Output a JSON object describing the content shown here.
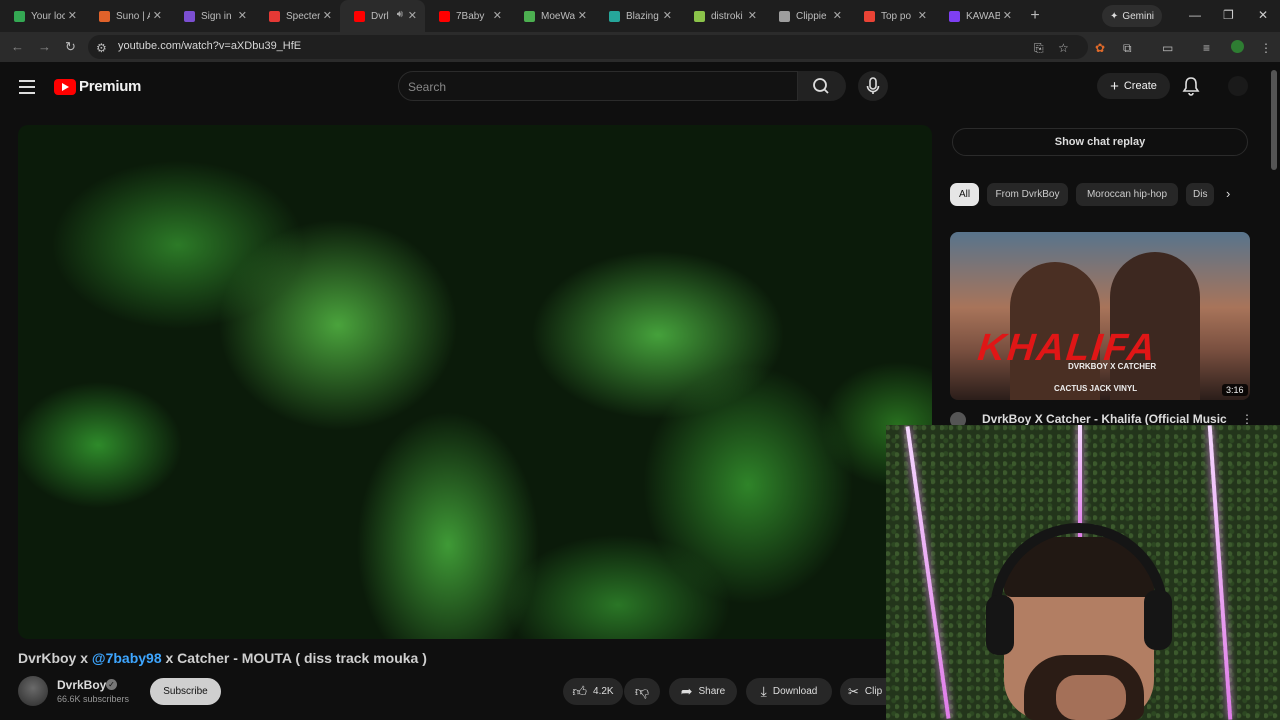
{
  "browser": {
    "tabs": [
      {
        "label": "Your loc",
        "color": "#34a853"
      },
      {
        "label": "Suno | A",
        "color": "#e0622a"
      },
      {
        "label": "Sign in",
        "color": "#7b4fd1"
      },
      {
        "label": "Specterr",
        "color": "#e53935"
      },
      {
        "label": "Dvrl",
        "color": "#ff0000"
      },
      {
        "label": "7Baby",
        "color": "#ff0000"
      },
      {
        "label": "MoeWa",
        "color": "#4caf50"
      },
      {
        "label": "Blazing",
        "color": "#26a69a"
      },
      {
        "label": "distroki",
        "color": "#8bc34a"
      },
      {
        "label": "Clippie",
        "color": "#9e9e9e"
      },
      {
        "label": "Top po",
        "color": "#ea4335"
      },
      {
        "label": "KAWAB",
        "color": "#7e3ff2"
      }
    ],
    "gemini_label": "Gemini",
    "url": "youtube.com/watch?v=aXDbu39_HfE"
  },
  "header": {
    "logo_text": "Premium",
    "search_placeholder": "Search",
    "create_label": "Create"
  },
  "video": {
    "title_prefix": "DvrKboy x ",
    "title_mention": "@7baby98",
    "title_suffix": " x Catcher - MOUTA ( diss track mouka )",
    "channel_name": "DvrkBoy",
    "subscribers": "66.6K subscribers",
    "subscribe_label": "Subscribe",
    "likes": "4.2K",
    "share_label": "Share",
    "download_label": "Download",
    "clip_label": "Clip"
  },
  "sidebar": {
    "chat_replay_label": "Show chat replay",
    "chips": [
      "All",
      "From DvrkBoy",
      "Moroccan hip-hop",
      "Dis"
    ],
    "recommendation": {
      "thumb_text": "KHALIFA",
      "thumb_subtitle": "DVRKBOY X CATCHER",
      "thumb_tags": "CACTUS JACK  VINYL",
      "duration": "3:16",
      "title": "DvrkBoy X Catcher - Khalifa (Official Music"
    }
  }
}
